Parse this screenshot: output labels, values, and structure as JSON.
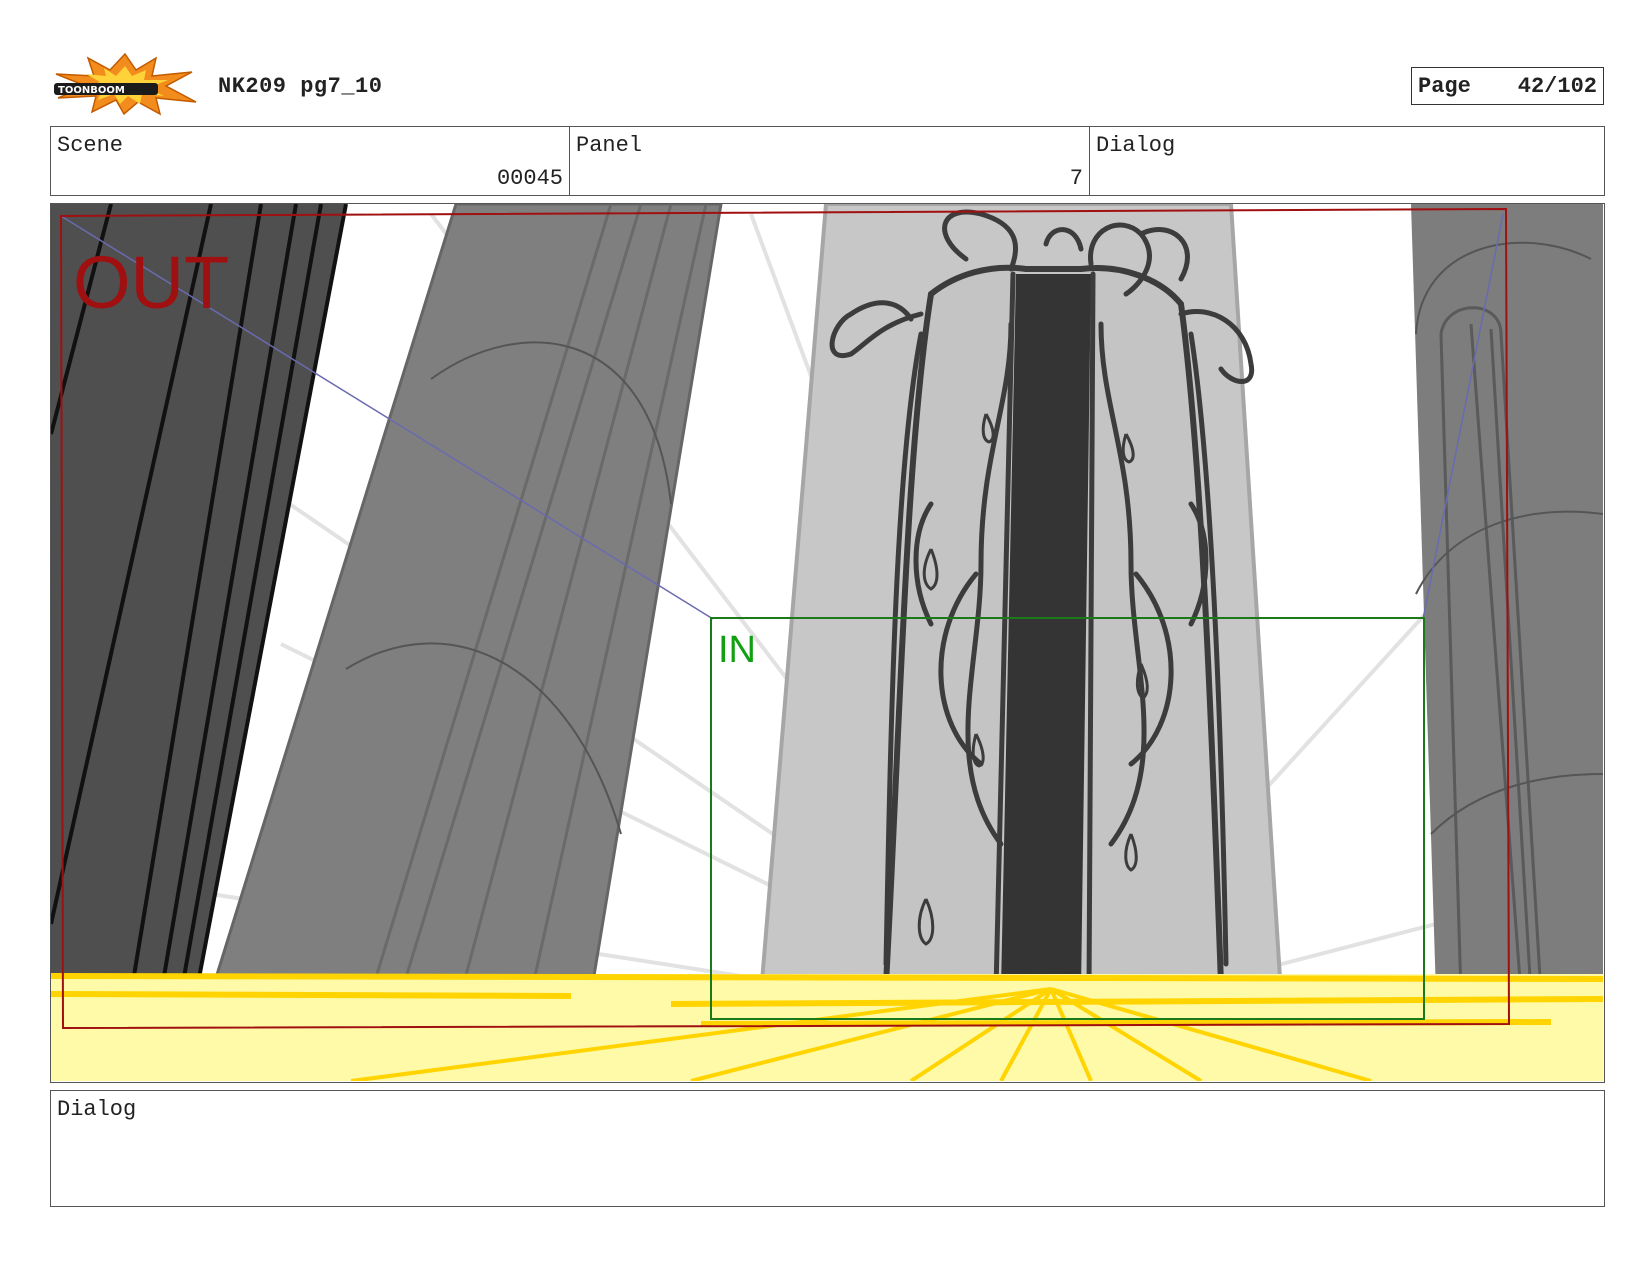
{
  "header": {
    "logo_text": "TOONBOOM",
    "title": "NK209 pg7_10",
    "page_label": "Page",
    "page_number": "42/102"
  },
  "info": {
    "scene_label": "Scene",
    "scene_value": "00045",
    "panel_label": "Panel",
    "panel_value": "7",
    "dialog_label": "Dialog"
  },
  "panel": {
    "out_label": "OUT",
    "in_label": "IN",
    "colors": {
      "out_frame": "#a01010",
      "in_frame": "#1a7a1a",
      "floor_glow": "#ffd400"
    }
  },
  "footer": {
    "dialog_label": "Dialog"
  }
}
